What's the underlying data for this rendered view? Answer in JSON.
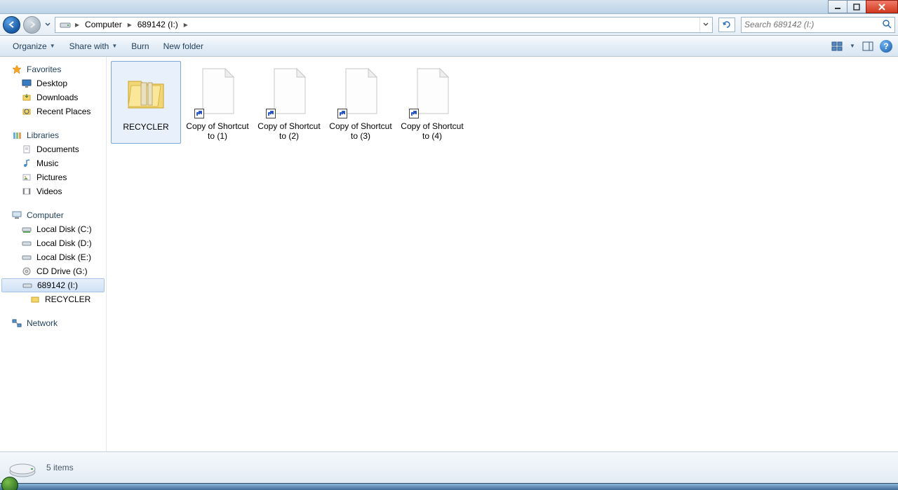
{
  "titlebar": {
    "min": "minimize",
    "max": "maximize",
    "close": "close"
  },
  "address": {
    "root": "Computer",
    "drive": "689142 (I:)"
  },
  "search": {
    "placeholder": "Search 689142 (I:)"
  },
  "toolbar": {
    "organize": "Organize",
    "share": "Share with",
    "burn": "Burn",
    "newfolder": "New folder"
  },
  "sidebar": {
    "favorites": {
      "label": "Favorites",
      "items": [
        {
          "label": "Desktop"
        },
        {
          "label": "Downloads"
        },
        {
          "label": "Recent Places"
        }
      ]
    },
    "libraries": {
      "label": "Libraries",
      "items": [
        {
          "label": "Documents"
        },
        {
          "label": "Music"
        },
        {
          "label": "Pictures"
        },
        {
          "label": "Videos"
        }
      ]
    },
    "computer": {
      "label": "Computer",
      "items": [
        {
          "label": "Local Disk (C:)"
        },
        {
          "label": "Local Disk (D:)"
        },
        {
          "label": "Local Disk (E:)"
        },
        {
          "label": "CD Drive (G:)"
        },
        {
          "label": "689142 (I:)",
          "selected": true,
          "children": [
            {
              "label": "RECYCLER"
            }
          ]
        }
      ]
    },
    "network": {
      "label": "Network"
    }
  },
  "files": [
    {
      "name": "RECYCLER",
      "type": "folder",
      "selected": true
    },
    {
      "name": "Copy of Shortcut to (1)",
      "type": "shortcut"
    },
    {
      "name": "Copy of Shortcut to (2)",
      "type": "shortcut"
    },
    {
      "name": "Copy of Shortcut to (3)",
      "type": "shortcut"
    },
    {
      "name": "Copy of Shortcut to (4)",
      "type": "shortcut"
    }
  ],
  "status": {
    "text": "5 items"
  }
}
